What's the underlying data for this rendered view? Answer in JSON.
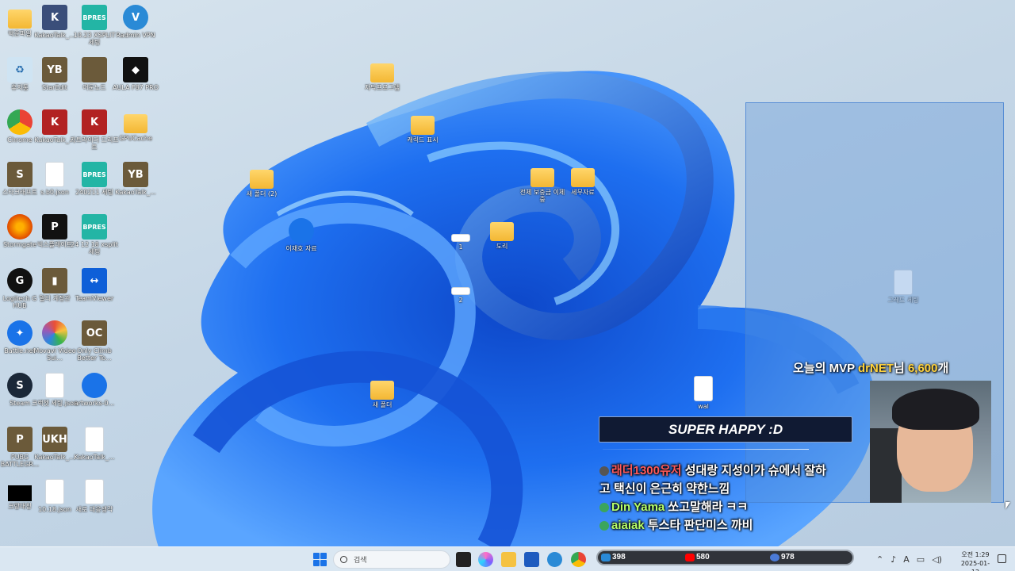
{
  "desktop_icons": [
    {
      "label": "박준파일",
      "kind": "folder",
      "glyph": ""
    },
    {
      "label": "KakaoTalk_...",
      "kind": "app",
      "glyph": "K"
    },
    {
      "label": "10.23 XSPLIT 세팅",
      "kind": "bpres",
      "glyph": "BPRES"
    },
    {
      "label": "Radmin VPN",
      "kind": "wa",
      "glyph": "V"
    },
    {
      "label": "휴지통",
      "kind": "recycle",
      "glyph": "♻"
    },
    {
      "label": "StarEdit",
      "kind": "game",
      "glyph": "YB"
    },
    {
      "label": "어둔노드",
      "kind": "game",
      "glyph": ""
    },
    {
      "label": "AULA F87 PRO",
      "kind": "dark",
      "glyph": "◆"
    },
    {
      "label": "Chrome",
      "kind": "chrome",
      "glyph": ""
    },
    {
      "label": "KakaoTalk_...",
      "kind": "red",
      "glyph": "K"
    },
    {
      "label": "카트라이더 드리프트",
      "kind": "red",
      "glyph": "K"
    },
    {
      "label": "GPUCache",
      "kind": "folder",
      "glyph": ""
    },
    {
      "label": "스타크래프트",
      "kind": "game",
      "glyph": "S"
    },
    {
      "label": "s.b0.json",
      "kind": "file",
      "glyph": ""
    },
    {
      "label": "240211 세팅",
      "kind": "bpres",
      "glyph": "BPRES"
    },
    {
      "label": "KakaoTalk_...",
      "kind": "game",
      "glyph": "YB"
    },
    {
      "label": "Stormgate",
      "kind": "orange",
      "glyph": ""
    },
    {
      "label": "빅스플레이트",
      "kind": "dark",
      "glyph": "P"
    },
    {
      "label": "24 12 18 xsplit 세팅",
      "kind": "bpres",
      "glyph": "BPRES"
    },
    {
      "label": "Logitech G HUB",
      "kind": "logi",
      "glyph": "G"
    },
    {
      "label": "멀티 계정관",
      "kind": "game",
      "glyph": "▮"
    },
    {
      "label": "TeamViewer",
      "kind": "teamv",
      "glyph": "↔"
    },
    {
      "label": "Battle.net",
      "kind": "blue",
      "glyph": "✦"
    },
    {
      "label": "Movavi Video Sui...",
      "kind": "movavi",
      "glyph": ""
    },
    {
      "label": "Only Climb Better To...",
      "kind": "game",
      "glyph": "OC"
    },
    {
      "label": "Steam",
      "kind": "steam",
      "glyph": "S"
    },
    {
      "label": "크랙쳇 세팅.json",
      "kind": "file",
      "glyph": ""
    },
    {
      "label": "artworks-0...",
      "kind": "blue",
      "glyph": ""
    },
    {
      "label": "PUBG BATTLEGR...",
      "kind": "game",
      "glyph": "P"
    },
    {
      "label": "KakaoTalk_...",
      "kind": "game",
      "glyph": "UKH"
    },
    {
      "label": "KakaoTalk_...",
      "kind": "file",
      "glyph": ""
    },
    {
      "label": "크랑대칭",
      "kind": "black",
      "glyph": ""
    },
    {
      "label": "10.18.json",
      "kind": "file",
      "glyph": ""
    },
    {
      "label": "새로 대응생각",
      "kind": "file",
      "glyph": ""
    }
  ],
  "scattered_icons": [
    {
      "label": "자막프로그램",
      "kind": "folder"
    },
    {
      "label": "캐릭드 표시",
      "kind": "folder"
    },
    {
      "label": "새 폴더 (2)",
      "kind": "folder"
    },
    {
      "label": "전체 보충금 이체중",
      "kind": "folder"
    },
    {
      "label": "세무자료",
      "kind": "folder"
    },
    {
      "label": "이재호 자료",
      "kind": "zip"
    },
    {
      "label": "1",
      "kind": "img"
    },
    {
      "label": "도리",
      "kind": "folder"
    },
    {
      "label": "2",
      "kind": "img"
    },
    {
      "label": "새 폴더",
      "kind": "folder"
    },
    {
      "label": "wal",
      "kind": "file"
    },
    {
      "label": "그레드 세팅",
      "kind": "file"
    }
  ],
  "overlay": {
    "mvp_prefix": "오늘의 MVP ",
    "mvp_name": "drNET",
    "mvp_mid": "님 ",
    "mvp_amount": "6,600",
    "mvp_suffix": "개",
    "donation_text": "SUPER HAPPY :D"
  },
  "chat": [
    {
      "nick": "래더1300유저",
      "msg": " 성대랑 지성이가 슈에서 잘하",
      "nick_color": "red"
    },
    {
      "nick": "",
      "msg": "고 택신이 은근히 약한느낌",
      "nick_color": ""
    },
    {
      "nick": "Din Yama",
      "msg": " 쏘고말해라 ㅋㅋ",
      "nick_color": "green"
    },
    {
      "nick": "aiaiak",
      "msg": " 투스타 판단미스 까비",
      "nick_color": "green"
    }
  ],
  "taskbar": {
    "search_placeholder": "검색",
    "stats": {
      "chzzk": "398",
      "youtube": "580",
      "soop": "978"
    },
    "clock_time": "오전 1:29",
    "clock_date": "2025-01-12",
    "tray_lang": "A"
  },
  "colors": {
    "accent": "#1a73e8",
    "mvp_highlight": "#ffd23c",
    "chat_red": "#ff5a5a",
    "chat_green": "#b6ff6a"
  }
}
